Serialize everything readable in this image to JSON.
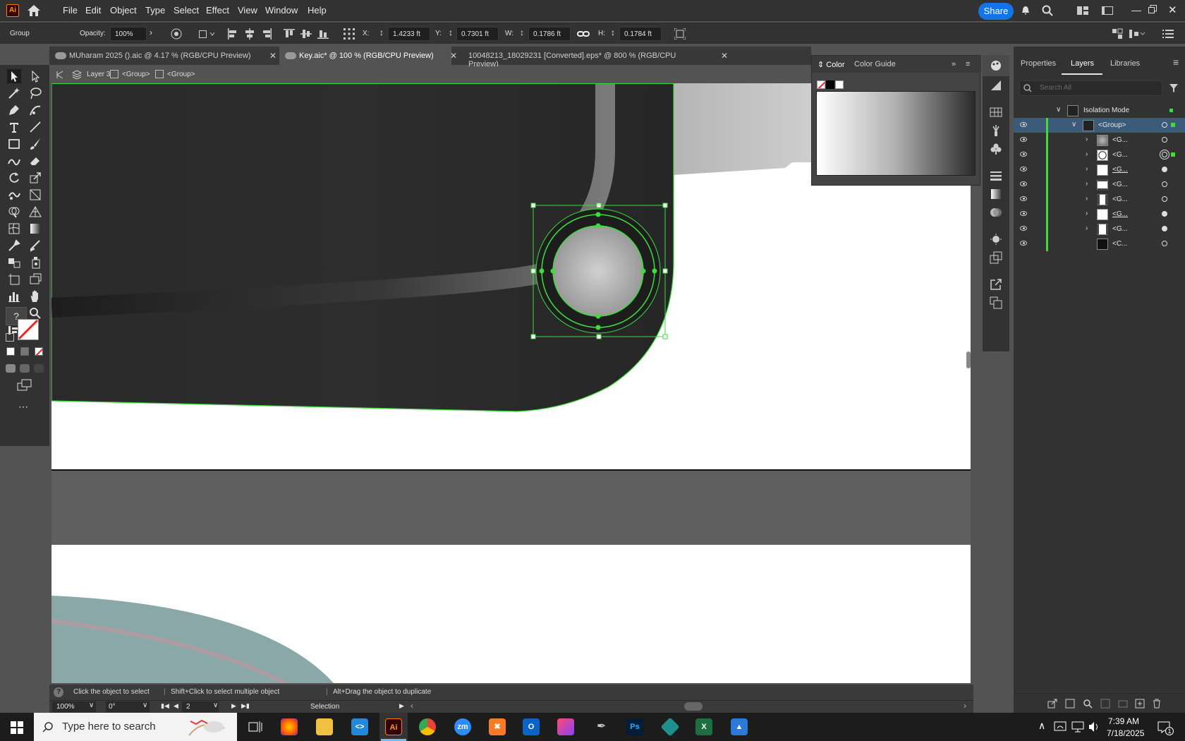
{
  "app": {
    "logo": "Ai",
    "menu": [
      "File",
      "Edit",
      "Object",
      "Type",
      "Select",
      "Effect",
      "View",
      "Window",
      "Help"
    ],
    "share_label": "Share"
  },
  "control_bar": {
    "selection_type": "Group",
    "opacity_label": "Opacity:",
    "opacity_value": "100%",
    "x_label": "X:",
    "x_value": "1.4233 ft",
    "y_label": "Y:",
    "y_value": "0.7301 ft",
    "w_label": "W:",
    "w_value": "0.1786 ft",
    "h_label": "H:",
    "h_value": "0.1784 ft"
  },
  "tabs": [
    {
      "label": "MUharam 2025 ().aic @ 4.17 % (RGB/CPU Preview)",
      "active": false
    },
    {
      "label": "Key.aic* @ 100 % (RGB/CPU Preview)",
      "active": true
    },
    {
      "label": "10048213_18029231 [Converted].eps* @ 800 % (RGB/CPU Preview)",
      "active": false
    }
  ],
  "breadcrumb": {
    "layer": "Layer 3",
    "group1": "<Group>",
    "group2": "<Group>"
  },
  "color_panel": {
    "tab_color": "Color",
    "tab_guide": "Color Guide"
  },
  "right_panel": {
    "tabs": [
      "Properties",
      "Layers",
      "Libraries"
    ],
    "search_placeholder": "Search All",
    "isolation_label": "Isolation Mode",
    "rows": [
      {
        "label": "<Group>",
        "selected": true
      },
      {
        "label": "<G...",
        "selected": false
      },
      {
        "label": "<G...",
        "selected": false
      },
      {
        "label": "<G...",
        "selected": false
      },
      {
        "label": "<G...",
        "selected": false
      },
      {
        "label": "<G...",
        "selected": false
      },
      {
        "label": "<G...",
        "selected": false
      },
      {
        "label": "<G...",
        "selected": false
      },
      {
        "label": "<C...",
        "selected": false
      }
    ]
  },
  "status": {
    "hint1": "Click the object to select",
    "hint2": "Shift+Click to select multiple object",
    "hint3": "Alt+Drag the object to duplicate",
    "zoom": "100%",
    "rotation": "0°",
    "artboard": "2",
    "tool": "Selection"
  },
  "taskbar": {
    "search_placeholder": "Type here to search",
    "time": "7:39 AM",
    "date": "7/18/2025",
    "notification_count": "1"
  },
  "colors": {
    "accent": "#1473e6",
    "selection": "#3ddc3d",
    "canvas_dark": "#272727"
  }
}
